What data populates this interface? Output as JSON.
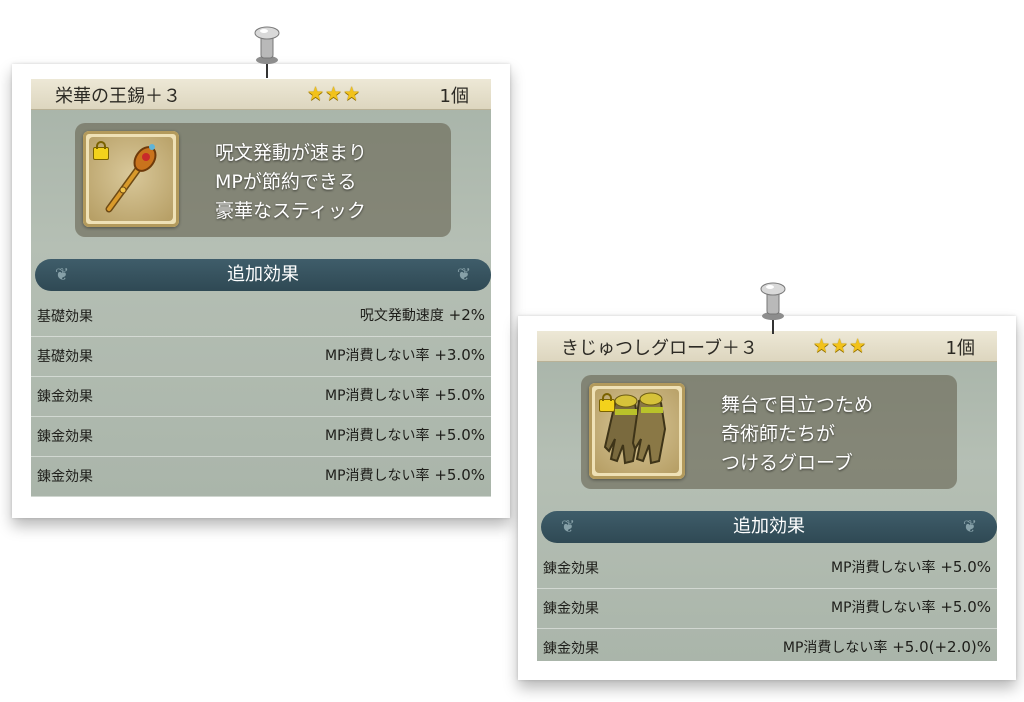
{
  "cards": [
    {
      "name": "栄華の王錫＋３",
      "stars": "★★★",
      "quantity": "1個",
      "icon": "golden-scepter-icon",
      "description": [
        "呪文発動が速まり",
        "MPが節約できる",
        "豪華なスティック"
      ],
      "effects_header": "追加効果",
      "effects": [
        {
          "type": "基礎効果",
          "effect": "呪文発動速度",
          "value": "+2%"
        },
        {
          "type": "基礎効果",
          "effect": "MP消費しない率",
          "value": "+3.0%"
        },
        {
          "type": "錬金効果",
          "effect": "MP消費しない率",
          "value": "+5.0%"
        },
        {
          "type": "錬金効果",
          "effect": "MP消費しない率",
          "value": "+5.0%"
        },
        {
          "type": "錬金効果",
          "effect": "MP消費しない率",
          "value": "+5.0%"
        }
      ]
    },
    {
      "name": "きじゅつしグローブ＋３",
      "stars": "★★★",
      "quantity": "1個",
      "icon": "glove-icon",
      "description": [
        "舞台で目立つため",
        "奇術師たちが",
        "つけるグローブ"
      ],
      "effects_header": "追加効果",
      "effects": [
        {
          "type": "錬金効果",
          "effect": "MP消費しない率",
          "value": "+5.0%"
        },
        {
          "type": "錬金効果",
          "effect": "MP消費しない率",
          "value": "+5.0%"
        },
        {
          "type": "錬金効果",
          "effect": "MP消費しない率",
          "value": "+5.0(+2.0)%"
        }
      ]
    }
  ],
  "colors": {
    "star": "#f2c21a",
    "header_bar": "#2f4954",
    "panel": "#b5bfb4"
  }
}
